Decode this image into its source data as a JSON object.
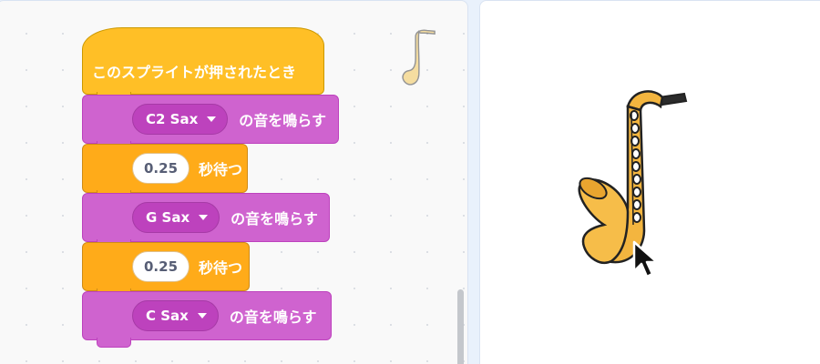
{
  "script": {
    "hat_label": "このスプライトが押されたとき",
    "blocks": [
      {
        "kind": "play-sound",
        "sound": "C2 Sax",
        "suffix": "の音を鳴らす"
      },
      {
        "kind": "wait",
        "seconds": "0.25",
        "suffix": "秒待つ"
      },
      {
        "kind": "play-sound",
        "sound": "G Sax",
        "suffix": "の音を鳴らす"
      },
      {
        "kind": "wait",
        "seconds": "0.25",
        "suffix": "秒待つ"
      },
      {
        "kind": "play-sound",
        "sound": "C Sax",
        "suffix": "の音を鳴らす"
      }
    ]
  },
  "sprite": {
    "name": "saxophone-icon"
  },
  "colors": {
    "events": "#ffbf26",
    "sound": "#cf63cf",
    "control": "#ffab19",
    "code_bg": "#f9f9f9",
    "stage_bg": "#ffffff"
  }
}
